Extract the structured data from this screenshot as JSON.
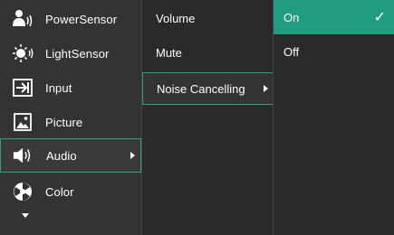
{
  "main_menu": {
    "items": [
      {
        "label": "PowerSensor",
        "icon": "power-sensor-icon"
      },
      {
        "label": "LightSensor",
        "icon": "light-sensor-icon"
      },
      {
        "label": "Input",
        "icon": "input-icon"
      },
      {
        "label": "Picture",
        "icon": "picture-icon"
      },
      {
        "label": "Audio",
        "icon": "audio-icon"
      },
      {
        "label": "Color",
        "icon": "color-icon"
      }
    ],
    "selected": "Audio"
  },
  "audio_menu": {
    "items": [
      {
        "label": "Volume"
      },
      {
        "label": "Mute"
      },
      {
        "label": "Noise Cancelling"
      }
    ],
    "selected": "Noise Cancelling"
  },
  "noise_cancelling_menu": {
    "items": [
      {
        "label": "On",
        "checked": true
      },
      {
        "label": "Off",
        "checked": false
      }
    ],
    "check_glyph": "✓"
  },
  "colors": {
    "accent": "#1f9c82",
    "panel": "#333333",
    "submenu": "#2a2a2a"
  }
}
